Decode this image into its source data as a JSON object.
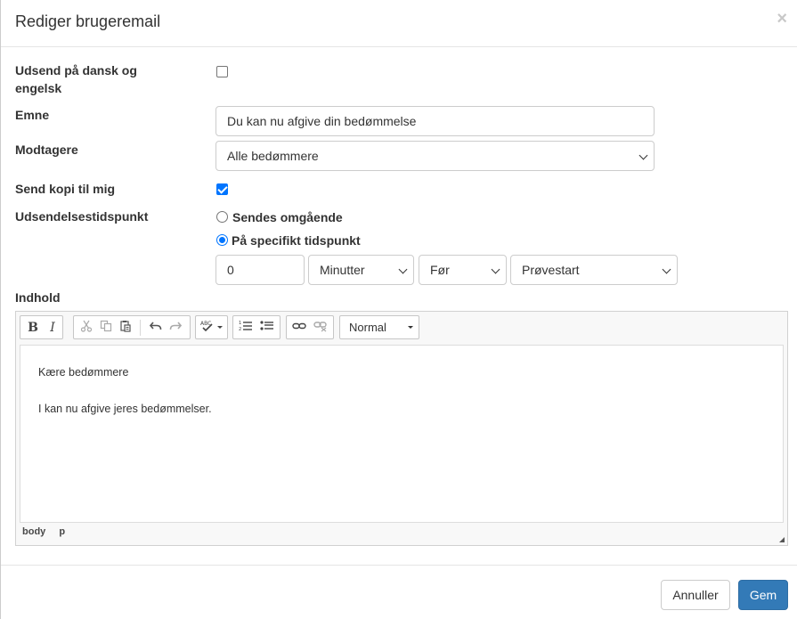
{
  "header": {
    "title": "Rediger brugeremail",
    "close_label": "×"
  },
  "form": {
    "bilingual_label": "Udsend på dansk og engelsk",
    "bilingual_checked": false,
    "subject_label": "Emne",
    "subject_value": "Du kan nu afgive din bedømmelse",
    "recipients_label": "Modtagere",
    "recipients_value": "Alle bedømmere",
    "copy_label": "Send kopi til mig",
    "copy_checked": true,
    "timing_label": "Udsendelsestidspunkt",
    "timing_options": [
      "Sendes omgående",
      "På specifikt tidspunkt"
    ],
    "timing_selected": "På specifikt tidspunkt",
    "timing_amount": "0",
    "timing_unit": "Minutter",
    "timing_relation": "Før",
    "timing_reference": "Prøvestart",
    "content_label": "Indhold"
  },
  "editor": {
    "toolbar": {
      "bold": "B",
      "italic": "I",
      "format_value": "Normal"
    },
    "paragraphs": [
      "Kære bedømmere",
      "I kan nu afgive jeres bedømmelser."
    ],
    "path": [
      "body",
      "p"
    ]
  },
  "footer": {
    "cancel_label": "Annuller",
    "save_label": "Gem"
  },
  "colors": {
    "primary": "#337ab7",
    "checkbox": "#0075ff"
  }
}
